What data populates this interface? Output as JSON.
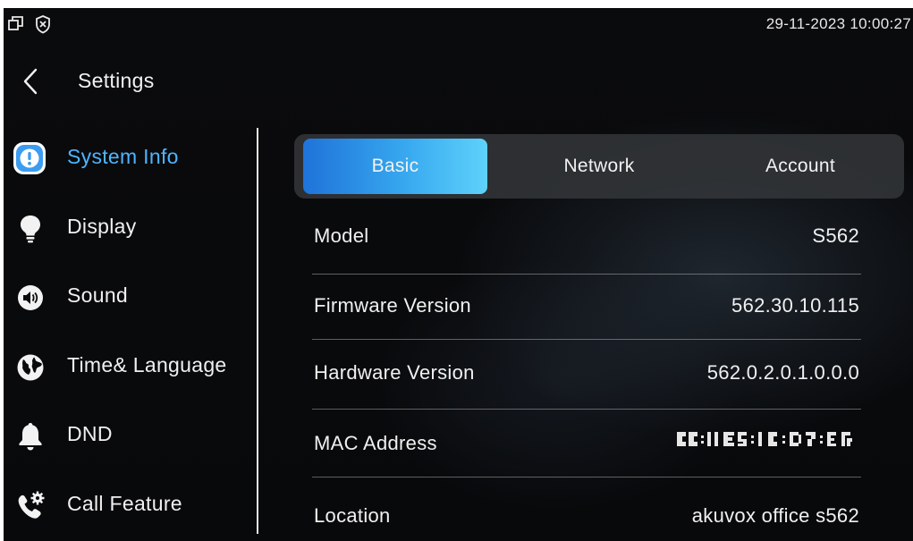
{
  "statusbar": {
    "time": "29-11-2023 10:00:27",
    "icons": [
      "windows-icon",
      "shield-x-icon"
    ]
  },
  "header": {
    "title": "Settings"
  },
  "sidebar": {
    "items": [
      {
        "label": "System Info",
        "icon": "info-icon",
        "active": true
      },
      {
        "label": "Display",
        "icon": "bulb-icon",
        "active": false
      },
      {
        "label": "Sound",
        "icon": "speaker-icon",
        "active": false
      },
      {
        "label": "Time& Language",
        "icon": "globe-icon",
        "active": false
      },
      {
        "label": "DND",
        "icon": "bell-icon",
        "active": false
      },
      {
        "label": "Call Feature",
        "icon": "phone-gear-icon",
        "active": false
      }
    ]
  },
  "tabs": [
    {
      "label": "Basic",
      "active": true
    },
    {
      "label": "Network",
      "active": false
    },
    {
      "label": "Account",
      "active": false
    }
  ],
  "info": {
    "rows": [
      {
        "key": "Model",
        "value": "S562"
      },
      {
        "key": "Firmware Version",
        "value": "562.30.10.115"
      },
      {
        "key": "Hardware Version",
        "value": "562.0.2.0.1.0.0.0"
      },
      {
        "key": "MAC Address",
        "value": "",
        "obscured": true
      },
      {
        "key": "Location",
        "value": "akuvox office s562"
      }
    ]
  },
  "colors": {
    "accent": "#4fb4ff",
    "tab_active_start": "#1f73d9",
    "tab_active_end": "#5ed2fb",
    "background": "#08090b"
  }
}
